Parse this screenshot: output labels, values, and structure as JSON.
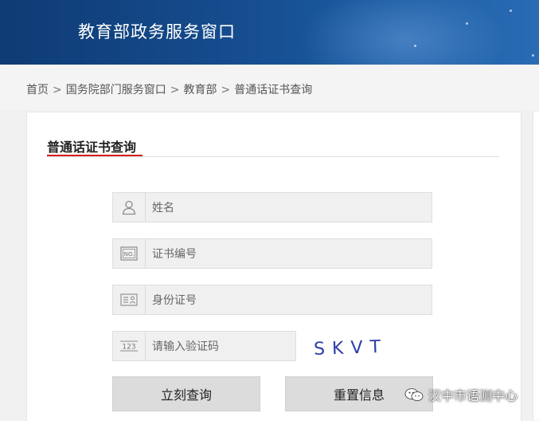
{
  "header": {
    "title": "教育部政务服务窗口"
  },
  "breadcrumb": {
    "items": [
      "首页",
      "国务院部门服务窗口",
      "教育部",
      "普通话证书查询"
    ],
    "separator": ">"
  },
  "panel": {
    "title": "普通话证书查询"
  },
  "form": {
    "name_placeholder": "姓名",
    "cert_placeholder": "证书编号",
    "id_placeholder": "身份证号",
    "captcha_placeholder": "请输入验证码",
    "captcha_code": "SKVT",
    "cert_icon_label": "NO.",
    "captcha_icon_label": "123"
  },
  "buttons": {
    "query": "立刻查询",
    "reset": "重置信息"
  },
  "watermark": {
    "text": "汉中市语测中心"
  },
  "colors": {
    "header": "#154b8c",
    "accent": "#d21e1e",
    "field_bg": "#f0f0f0"
  }
}
